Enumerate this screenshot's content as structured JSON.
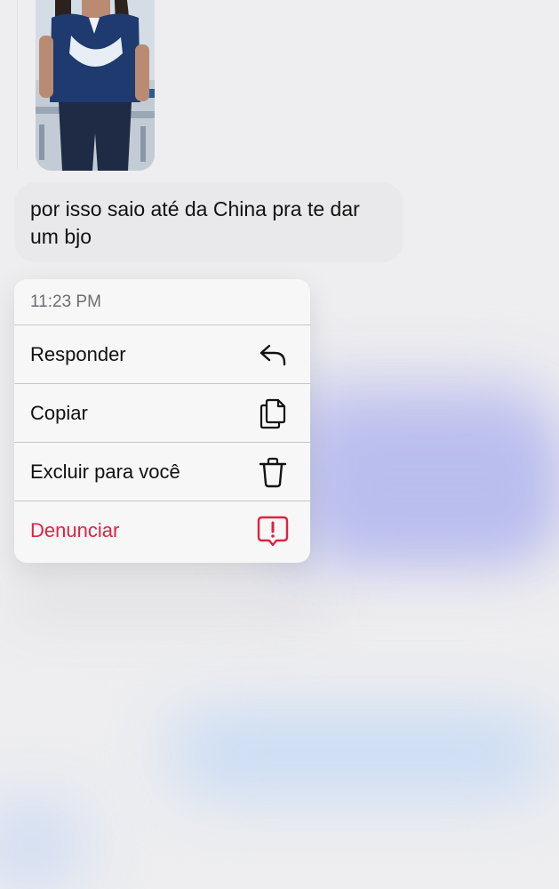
{
  "message": {
    "text": "por isso saio até da China pra te dar um bjo"
  },
  "context_menu": {
    "timestamp": "11:23 PM",
    "items": [
      {
        "label": "Responder",
        "icon": "reply-icon"
      },
      {
        "label": "Copiar",
        "icon": "copy-icon"
      },
      {
        "label": "Excluir para você",
        "icon": "trash-icon"
      },
      {
        "label": "Denunciar",
        "icon": "report-icon",
        "color": "#e0223f"
      }
    ]
  },
  "colors": {
    "background": "#efeff1",
    "bubble": "#e9e9eb",
    "menu": "#f7f7f8",
    "danger": "#e0223f",
    "muted_text": "#6d6d72"
  }
}
